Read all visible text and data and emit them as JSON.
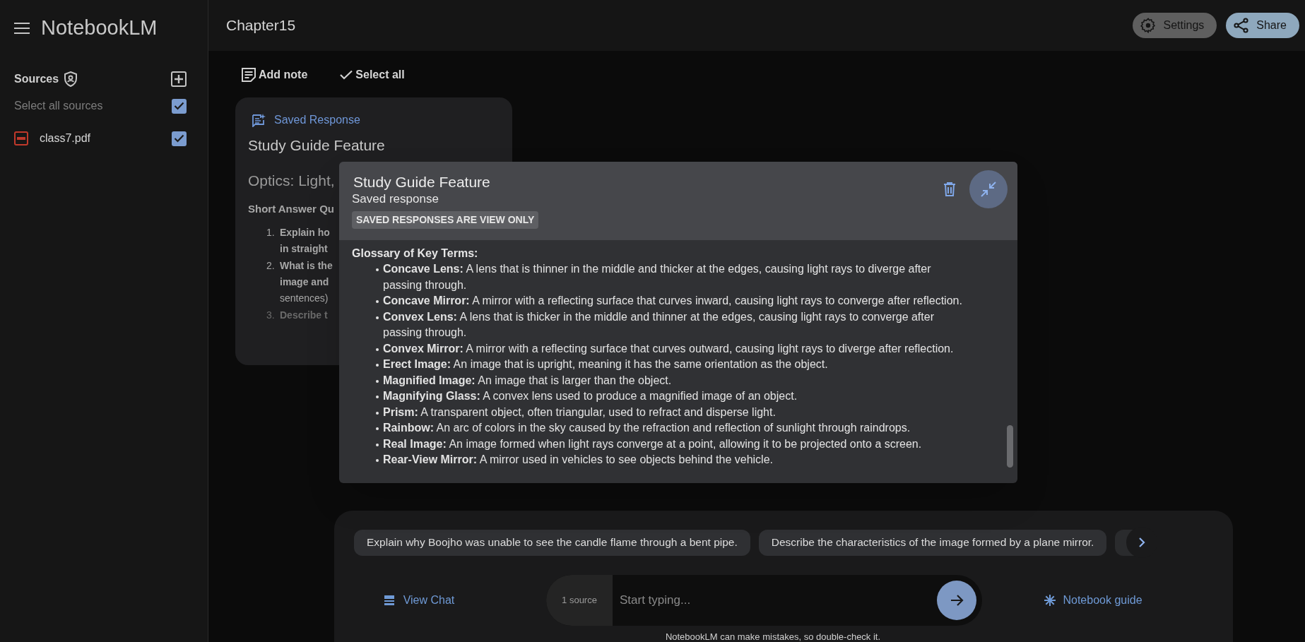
{
  "app": {
    "title": "NotebookLM"
  },
  "notebook": {
    "title": "Chapter15"
  },
  "header_buttons": [
    {
      "label": "Settings",
      "kind": "settings"
    },
    {
      "label": "Share",
      "kind": "share"
    }
  ],
  "sources": {
    "heading": "Sources",
    "select_all": {
      "label": "Select all sources",
      "checked": true
    },
    "items": [
      {
        "name": "class7.pdf",
        "checked": true
      }
    ]
  },
  "toolbar": [
    {
      "label": "Add note",
      "kind": "note"
    },
    {
      "label": "Select all",
      "kind": "check"
    }
  ],
  "note_card": {
    "tag": "Saved Response",
    "title": "Study Guide Feature",
    "heading": "Optics: Light,",
    "section": "Short Answer Qu",
    "items": [
      {
        "number": "1.",
        "lines": [
          "**Explain ho**",
          "**in straight**"
        ]
      },
      {
        "number": "2.",
        "lines": [
          "**What is the**",
          "**image and**",
          "sentences)"
        ]
      },
      {
        "number": "3.",
        "lines": [
          "**Describe t**"
        ]
      }
    ]
  },
  "modal": {
    "title": "Study Guide Feature",
    "subtitle": "Saved response",
    "badge": "SAVED RESPONSES ARE VIEW ONLY",
    "heading": "Glossary of Key Terms:",
    "terms": [
      {
        "term": "Concave Lens:",
        "definition": "A lens that is thinner in the middle and thicker at the edges, causing light rays to diverge after passing through."
      },
      {
        "term": "Concave Mirror:",
        "definition": "A mirror with a reflecting surface that curves inward, causing light rays to converge after reflection."
      },
      {
        "term": "Convex Lens:",
        "definition": "A lens that is thicker in the middle and thinner at the edges, causing light rays to converge after passing through."
      },
      {
        "term": "Convex Mirror:",
        "definition": "A mirror with a reflecting surface that curves outward, causing light rays to diverge after reflection."
      },
      {
        "term": "Erect Image:",
        "definition": "An image that is upright, meaning it has the same orientation as the object."
      },
      {
        "term": "Magnified Image:",
        "definition": "An image that is larger than the object."
      },
      {
        "term": "Magnifying Glass:",
        "definition": "A convex lens used to produce a magnified image of an object."
      },
      {
        "term": "Prism:",
        "definition": "A transparent object, often triangular, used to refract and disperse light."
      },
      {
        "term": "Rainbow:",
        "definition": "An arc of colors in the sky caused by the refraction and reflection of sunlight through raindrops."
      },
      {
        "term": "Real Image:",
        "definition": "An image formed when light rays converge at a point, allowing it to be projected onto a screen."
      },
      {
        "term": "Rear-View Mirror:",
        "definition": "A mirror used in vehicles to see objects behind the vehicle."
      }
    ]
  },
  "chat": {
    "suggestions": [
      "Explain why Boojho was unable to see the candle flame through a bent pipe.",
      "Describe the characteristics of the image formed by a plane mirror."
    ],
    "view_chat": "View Chat",
    "source_count": "1 source",
    "placeholder": "Start typing...",
    "notebook_guide": "Notebook guide",
    "disclaimer": "NotebookLM can make mistakes, so double-check it."
  }
}
